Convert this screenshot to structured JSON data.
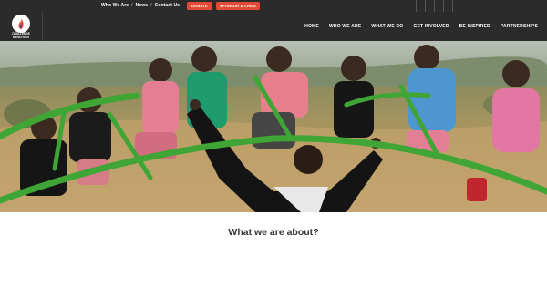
{
  "topbar": {
    "links": [
      "Who We Are",
      "News",
      "Contact Us"
    ],
    "separator": "/",
    "donate_label": "DONATE",
    "sponsor_label": "SPONSOR A CHILD"
  },
  "logo": {
    "line1": "CHALLENGE",
    "line2": "MINISTRIES"
  },
  "nav": {
    "items": [
      "HOME",
      "WHO WE ARE",
      "WHAT WE DO",
      "GET INVOLVED",
      "BE INSPIRED",
      "PARTNERSHIPS"
    ]
  },
  "main": {
    "section_title": "What we are about?"
  },
  "colors": {
    "bar_bg": "#2b2b2b",
    "accent": "#e24c36",
    "frame_green": "#3fa535"
  }
}
